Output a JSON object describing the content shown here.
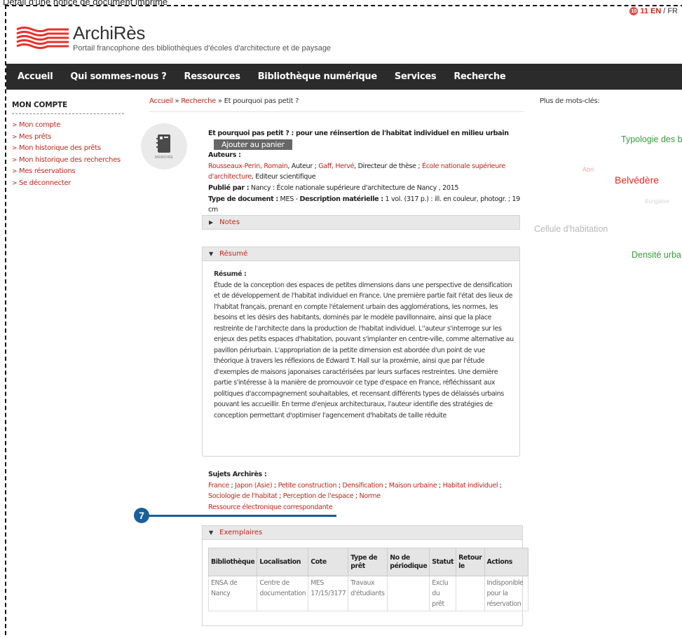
{
  "caption": "Détail d'une notice de document imprimé",
  "lang": {
    "count": "11",
    "badge": "10",
    "en": "EN",
    "sep": "/",
    "fr": "FR"
  },
  "brand": {
    "name": "ArchiRès",
    "tagline": "Portail francophone des bibliothèques d'écoles d'architecture et de paysage"
  },
  "nav": [
    "Accueil",
    "Qui sommes-nous ?",
    "Ressources",
    "Bibliothèque numérique",
    "Services",
    "Recherche"
  ],
  "sidebar": {
    "title": "MON COMPTE",
    "items": [
      "Mon compte",
      "Mes prêts",
      "Mon historique des prêts",
      "Mon historique des recherches",
      "Mes réservations",
      "Se déconnecter"
    ]
  },
  "breadcrumb": {
    "home": "Accueil",
    "sep": " » ",
    "search": "Recherche",
    "current": "Et pourquoi pas petit ?"
  },
  "doc_type_label": "MÉMOIRE",
  "notice": {
    "title": "Et pourquoi pas petit ? : pour une réinsertion de l'habitat individuel en milieu urbain",
    "cart_button": "Ajouter au panier",
    "authors_label": "Auteurs :",
    "author1": "Rousseaux-Perin, Romain",
    "author1_role": ", Auteur ; ",
    "author2": "Gaff, Hervé",
    "author2_role": ", Directeur de thèse ; ",
    "author3": "École nationale supérieure d'architecture",
    "author3_role": ", Editeur scientifique",
    "published_label": "Publié par :",
    "published_value": " Nancy : École nationale supérieure d'architecture de Nancy , 2015",
    "doctype_label": "Type de document :",
    "doctype_value": " MES - ",
    "desc_label": "Description matérielle :",
    "desc_value": " 1 vol. (317 p.) : ill. en couleur, photogr. ; 19 cm"
  },
  "notes_label": "Notes",
  "resume_label": "Résumé",
  "resume": {
    "heading": "Résumé :",
    "text": "Étude de la conception des espaces de petites dimensions dans une perspective de densification et de développement de l'habitat individuel en France. Une première partie fait l'état des lieux de l'habitat français, prenant en compte l'étalement urbain des agglomérations, les normes, les besoins et les désirs des habitants, dominés par le modèle pavillonnaire, ainsi que la place restreinte de l'architecte dans la production de l'habitat individuel. L''auteur s'interroge sur les enjeux des petits espaces d'habitation, pouvant s'implanter en centre-ville, comme alternative au pavillon périurbain. L'appropriation de la petite dimension est abordée d'un point de vue théorique à travers les réflexions de Edward T. Hall sur la proxémie, ainsi que par l'étude d'exemples de maisons japonaises caractérisées par leurs surfaces restreintes. Une dernière partie s'intéresse à la manière de promouvoir ce type d'espace en France, réfléchissant aux politiques d'accompagnement souhaitables, et recensant différents types de délaissés urbains pouvant les accueillir. En terme d'enjeux architecturaux, l'auteur identifie des stratégies de conception permettant d'optimiser l'agencement d'habitats de taille réduite"
  },
  "subjects": {
    "heading": "Sujets Archirès :",
    "items": [
      "France",
      "Japon (Asie)",
      "Petite construction",
      "Densification",
      "Maison urbaine",
      "Habitat individuel",
      "Sociologie de l'habitat",
      "Perception de l'espace",
      "Norme"
    ],
    "resource_link": "Ressource électronique correspondante"
  },
  "callout": "7",
  "exemplaires": {
    "label": "Exemplaires",
    "headers": [
      "Bibliothèque",
      "Localisation",
      "Cote",
      "Type de prêt",
      "No de périodique",
      "Statut",
      "Retour le",
      "Actions"
    ],
    "row": [
      "ENSA de Nancy",
      "Centre de documentation",
      "MES 17/15/3177",
      "Travaux d'étudiants",
      "",
      "Exclu du prêt",
      "",
      "Indisponible pour la réservation"
    ]
  },
  "keywords": {
    "heading": "Plus de mots-clés:",
    "items": [
      "Typologie des b",
      "Abri",
      "Belvédère",
      "Bungalow",
      "Cellule d'habitation",
      "Densité urba"
    ],
    "colors": {
      "green": "#3a9a3a",
      "red": "#e02a1f",
      "pink": "#f0a8a0",
      "grey": "#b8b8b8",
      "lightgrey": "#d8d8d8"
    }
  }
}
